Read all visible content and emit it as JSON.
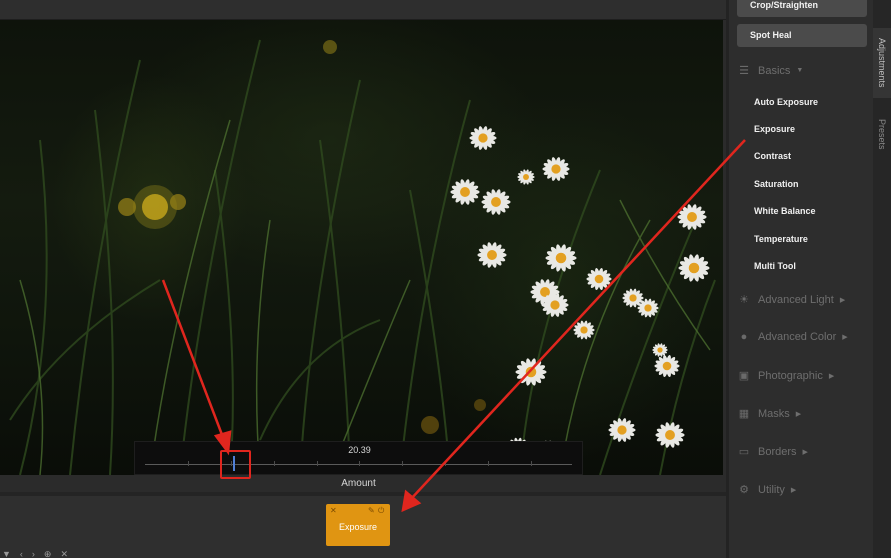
{
  "slider": {
    "value": "20.39",
    "label": "Amount",
    "position_fraction": 0.205
  },
  "adjustment_tile": {
    "label": "Exposure"
  },
  "panel": {
    "tools": [
      {
        "label": "Crop/Straighten"
      },
      {
        "label": "Spot Heal"
      }
    ],
    "basics": {
      "title": "Basics",
      "items": [
        "Auto Exposure",
        "Exposure",
        "Contrast",
        "Saturation",
        "White Balance",
        "Temperature",
        "Multi Tool"
      ]
    },
    "sections": [
      {
        "label": "Advanced Light",
        "icon": "sun-icon"
      },
      {
        "label": "Advanced Color",
        "icon": "color-drop-icon"
      },
      {
        "label": "Photographic",
        "icon": "camera-icon"
      },
      {
        "label": "Masks",
        "icon": "mask-icon"
      },
      {
        "label": "Borders",
        "icon": "border-icon"
      },
      {
        "label": "Utility",
        "icon": "utility-icon"
      }
    ]
  },
  "side_tabs": {
    "adjustments": "Adjustments",
    "presets": "Presets"
  },
  "colors": {
    "accent_tile": "#e09512",
    "highlight": "#e0261e",
    "slider_thumb": "#4f7fd6"
  }
}
